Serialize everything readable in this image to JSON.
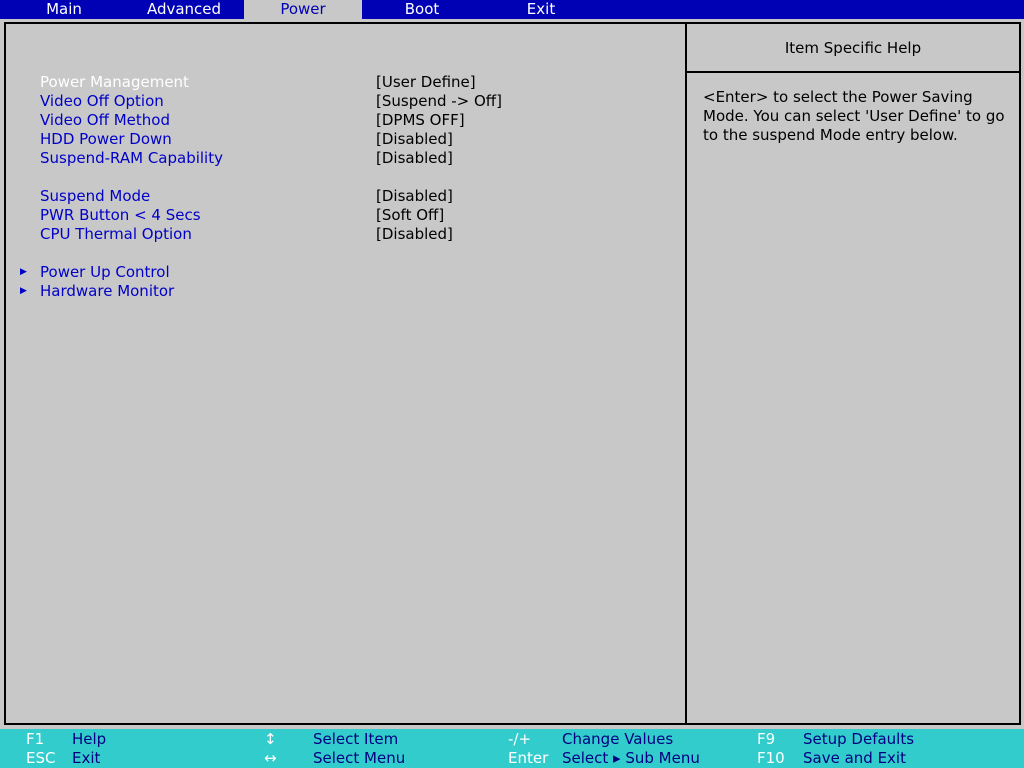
{
  "tabs": [
    "Main",
    "Advanced",
    "Power",
    "Boot",
    "Exit"
  ],
  "active_tab": "Power",
  "settings": [
    {
      "label": "Power Management",
      "value": "[User Define]",
      "selected": true
    },
    {
      "label": "Video Off Option",
      "value": "[Suspend -> Off]"
    },
    {
      "label": "Video Off Method",
      "value": "[DPMS OFF]"
    },
    {
      "label": "HDD Power Down",
      "value": "[Disabled]"
    },
    {
      "label": "Suspend-RAM Capability",
      "value": "[Disabled]"
    },
    {
      "label": "Suspend Mode",
      "value": "[Disabled]"
    },
    {
      "label": "PWR Button < 4 Secs",
      "value": "[Soft Off]"
    },
    {
      "label": "CPU Thermal Option",
      "value": "[Disabled]"
    }
  ],
  "submenus": [
    "Power Up Control",
    "Hardware Monitor"
  ],
  "help": {
    "title": "Item Specific Help",
    "text": "<Enter> to select the Power Saving Mode. You can select 'User Define' to go to the suspend Mode entry below."
  },
  "keys": {
    "f1": "F1",
    "f1_desc": "Help",
    "esc": "ESC",
    "esc_desc": "Exit",
    "updown": "↕",
    "updown_desc": "Select Item",
    "leftright": "↔",
    "leftright_desc": "Select Menu",
    "plusminus": "-/+",
    "plusminus_desc": "Change Values",
    "enter": "Enter",
    "enter_desc": "Select ▸ Sub Menu",
    "f9": "F9",
    "f9_desc": "Setup Defaults",
    "f10": "F10",
    "f10_desc": "Save and Exit"
  },
  "colors": {
    "menubar": "#0000b4",
    "background": "#c8c8c8",
    "item_text": "#0000c8",
    "selected_text": "#ffffff",
    "keybar": "#33cccc"
  }
}
